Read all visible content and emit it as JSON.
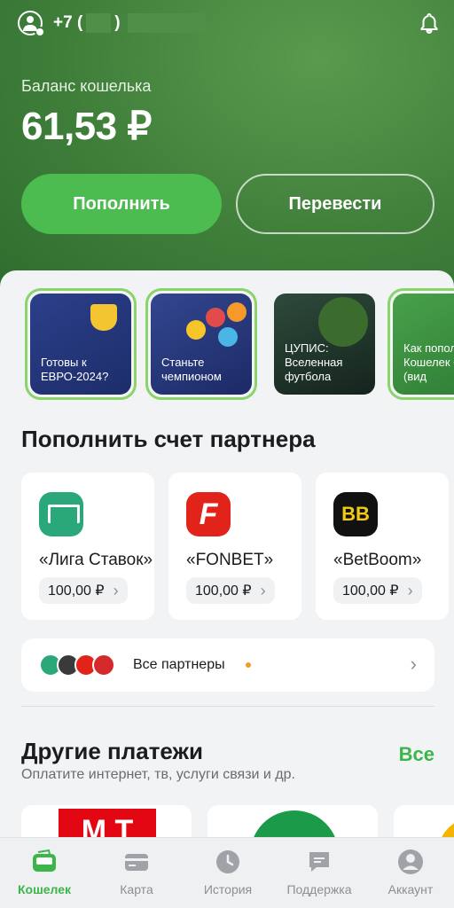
{
  "header": {
    "phone_prefix": "+7 (",
    "phone_paren": ")",
    "balance_label": "Баланс кошелька",
    "balance": "61,53 ₽",
    "topup_label": "Пополнить",
    "transfer_label": "Перевести"
  },
  "stories": [
    {
      "text": "Готовы к ЕВРО-2024?"
    },
    {
      "text": "Станьте чемпионом"
    },
    {
      "text": "ЦУПИС: Вселенная футбола"
    },
    {
      "text": "Как попол Кошелек СБП (вид"
    }
  ],
  "partners_section": {
    "title": "Пополнить счет партнера",
    "items": [
      {
        "name": "«Лига Ставок»",
        "amount": "100,00 ₽"
      },
      {
        "name": "«FONBET»",
        "amount": "100,00 ₽"
      },
      {
        "name": "«BetBoom»",
        "amount": "100,00 ₽"
      }
    ],
    "all_label": "Все партнеры"
  },
  "other_payments": {
    "title": "Другие платежи",
    "all_link": "Все",
    "subtitle": "Оплатите интернет, тв, услуги связи и др.",
    "mts_text": "М Т"
  },
  "tabs": [
    {
      "label": "Кошелек",
      "icon": "wallet-icon",
      "active": true
    },
    {
      "label": "Карта",
      "icon": "card-icon"
    },
    {
      "label": "История",
      "icon": "clock-icon"
    },
    {
      "label": "Поддержка",
      "icon": "chat-icon"
    },
    {
      "label": "Аккаунт",
      "icon": "account-icon"
    }
  ],
  "colors": {
    "header_green": "#3f7f3a",
    "accent_green": "#3cb54a",
    "button_green": "#4cbb50"
  }
}
